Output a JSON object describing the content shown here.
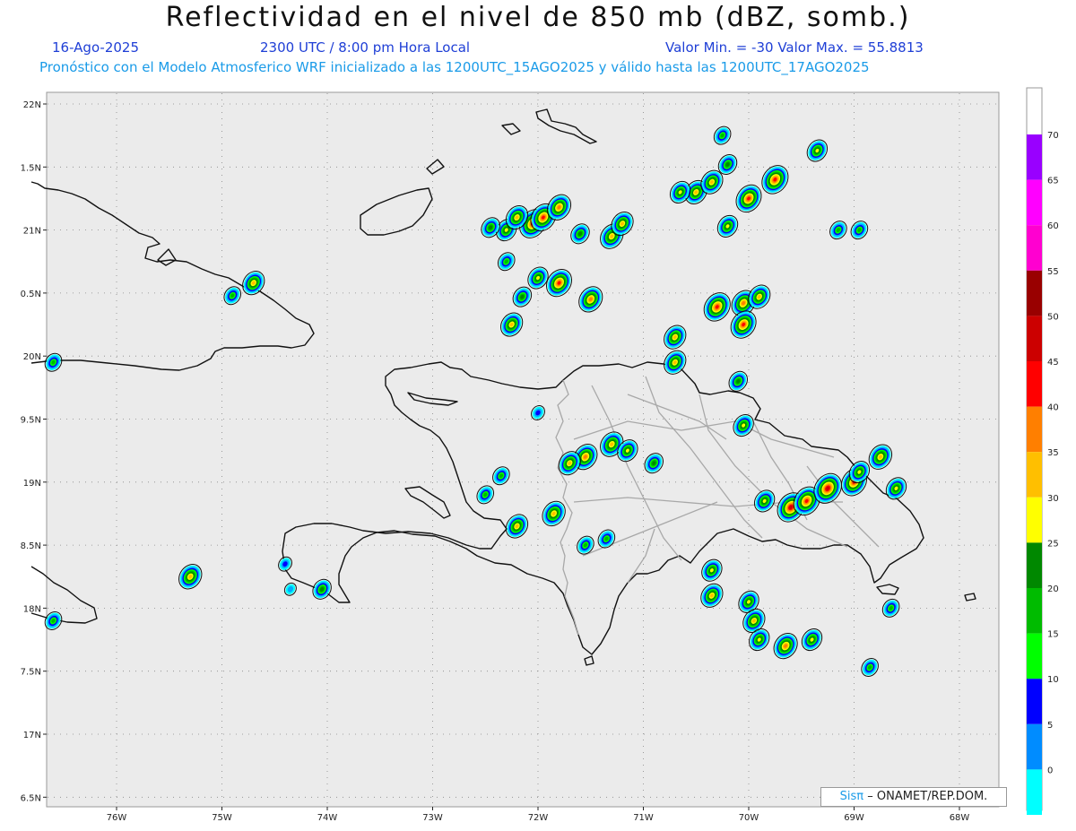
{
  "header": {
    "title": "Reflectividad en el nivel de 850 mb (dBZ, somb.)",
    "date": "16-Ago-2025",
    "time": "2300 UTC / 8:00 pm Hora Local",
    "minmax": "Valor Min. = -30  Valor Max. = 55.8813",
    "forecast": "Pronóstico con el Modelo Atmosferico WRF inicializado a las 1200UTC_15AGO2025 y válido hasta las  1200UTC_17AGO2025"
  },
  "axes": {
    "lat_labels": [
      "22N",
      "1.5N",
      "21N",
      "0.5N",
      "20N",
      "9.5N",
      "19N",
      "8.5N",
      "18N",
      "7.5N",
      "17N",
      "6.5N"
    ],
    "lon_labels": [
      "76W",
      "75W",
      "74W",
      "73W",
      "72W",
      "71W",
      "70W",
      "69W",
      "68W"
    ]
  },
  "colorbar": {
    "labels": [
      "70",
      "65",
      "60",
      "55",
      "50",
      "45",
      "40",
      "35",
      "30",
      "25",
      "20",
      "15",
      "10",
      "5",
      "0"
    ],
    "colors": [
      "#9900ff",
      "#ff00ff",
      "#ff00d0",
      "#990000",
      "#cc0000",
      "#ff0000",
      "#ff7f00",
      "#ffbf00",
      "#ffff00",
      "#008800",
      "#00bb00",
      "#00ff00",
      "#0000ff",
      "#008cff",
      "#00ffff"
    ]
  },
  "credit": {
    "logo": "Sisπ",
    "text": "– ONAMET/REP.DOM."
  },
  "cells": [
    {
      "lon": -72.05,
      "lat": 21.05,
      "dbz": 48
    },
    {
      "lon": -71.95,
      "lat": 21.1,
      "dbz": 45
    },
    {
      "lon": -71.8,
      "lat": 21.18,
      "dbz": 40
    },
    {
      "lon": -72.3,
      "lat": 21.0,
      "dbz": 30
    },
    {
      "lon": -72.2,
      "lat": 21.1,
      "dbz": 35
    },
    {
      "lon": -71.3,
      "lat": 20.95,
      "dbz": 38
    },
    {
      "lon": -71.6,
      "lat": 20.97,
      "dbz": 25
    },
    {
      "lon": -72.3,
      "lat": 20.75,
      "dbz": 20
    },
    {
      "lon": -71.8,
      "lat": 20.58,
      "dbz": 45
    },
    {
      "lon": -72.0,
      "lat": 20.62,
      "dbz": 30
    },
    {
      "lon": -71.5,
      "lat": 20.45,
      "dbz": 40
    },
    {
      "lon": -72.15,
      "lat": 20.47,
      "dbz": 25
    },
    {
      "lon": -72.25,
      "lat": 20.25,
      "dbz": 35
    },
    {
      "lon": -70.3,
      "lat": 20.39,
      "dbz": 48
    },
    {
      "lon": -70.05,
      "lat": 20.42,
      "dbz": 40
    },
    {
      "lon": -69.9,
      "lat": 20.47,
      "dbz": 35
    },
    {
      "lon": -70.05,
      "lat": 20.25,
      "dbz": 45
    },
    {
      "lon": -70.7,
      "lat": 20.15,
      "dbz": 35
    },
    {
      "lon": -70.7,
      "lat": 19.95,
      "dbz": 35
    },
    {
      "lon": -70.1,
      "lat": 19.8,
      "dbz": 25
    },
    {
      "lon": -70.0,
      "lat": 21.25,
      "dbz": 45
    },
    {
      "lon": -69.75,
      "lat": 21.4,
      "dbz": 48
    },
    {
      "lon": -70.5,
      "lat": 21.3,
      "dbz": 35
    },
    {
      "lon": -70.65,
      "lat": 21.3,
      "dbz": 30
    },
    {
      "lon": -70.35,
      "lat": 21.38,
      "dbz": 35
    },
    {
      "lon": -70.2,
      "lat": 21.52,
      "dbz": 25
    },
    {
      "lon": -70.25,
      "lat": 21.75,
      "dbz": 20
    },
    {
      "lon": -70.2,
      "lat": 21.03,
      "dbz": 30
    },
    {
      "lon": -69.35,
      "lat": 21.63,
      "dbz": 30
    },
    {
      "lon": -69.15,
      "lat": 21.0,
      "dbz": 20
    },
    {
      "lon": -68.95,
      "lat": 21.0,
      "dbz": 20
    },
    {
      "lon": -72.45,
      "lat": 21.02,
      "dbz": 25
    },
    {
      "lon": -71.2,
      "lat": 21.05,
      "dbz": 35
    },
    {
      "lon": -71.3,
      "lat": 19.3,
      "dbz": 38
    },
    {
      "lon": -71.15,
      "lat": 19.25,
      "dbz": 30
    },
    {
      "lon": -71.55,
      "lat": 19.2,
      "dbz": 40
    },
    {
      "lon": -71.7,
      "lat": 19.15,
      "dbz": 35
    },
    {
      "lon": -70.9,
      "lat": 19.15,
      "dbz": 25
    },
    {
      "lon": -70.05,
      "lat": 19.45,
      "dbz": 30
    },
    {
      "lon": -69.6,
      "lat": 18.8,
      "dbz": 50
    },
    {
      "lon": -69.45,
      "lat": 18.85,
      "dbz": 48
    },
    {
      "lon": -69.25,
      "lat": 18.95,
      "dbz": 52
    },
    {
      "lon": -69.0,
      "lat": 19.0,
      "dbz": 45
    },
    {
      "lon": -68.75,
      "lat": 19.2,
      "dbz": 38
    },
    {
      "lon": -68.6,
      "lat": 18.95,
      "dbz": 30
    },
    {
      "lon": -68.95,
      "lat": 19.08,
      "dbz": 30
    },
    {
      "lon": -69.85,
      "lat": 18.85,
      "dbz": 30
    },
    {
      "lon": -71.85,
      "lat": 18.75,
      "dbz": 38
    },
    {
      "lon": -72.2,
      "lat": 18.65,
      "dbz": 35
    },
    {
      "lon": -72.5,
      "lat": 18.9,
      "dbz": 20
    },
    {
      "lon": -72.35,
      "lat": 19.05,
      "dbz": 20
    },
    {
      "lon": -74.4,
      "lat": 18.35,
      "dbz": 10
    },
    {
      "lon": -74.35,
      "lat": 18.15,
      "dbz": 5
    },
    {
      "lon": -75.3,
      "lat": 18.25,
      "dbz": 38
    },
    {
      "lon": -76.6,
      "lat": 17.9,
      "dbz": 20
    },
    {
      "lon": -74.05,
      "lat": 18.15,
      "dbz": 25
    },
    {
      "lon": -70.35,
      "lat": 18.3,
      "dbz": 30
    },
    {
      "lon": -70.35,
      "lat": 18.1,
      "dbz": 35
    },
    {
      "lon": -70.0,
      "lat": 18.05,
      "dbz": 30
    },
    {
      "lon": -69.95,
      "lat": 17.9,
      "dbz": 35
    },
    {
      "lon": -69.9,
      "lat": 17.75,
      "dbz": 30
    },
    {
      "lon": -69.65,
      "lat": 17.7,
      "dbz": 40
    },
    {
      "lon": -69.4,
      "lat": 17.75,
      "dbz": 30
    },
    {
      "lon": -68.85,
      "lat": 17.53,
      "dbz": 20
    },
    {
      "lon": -68.65,
      "lat": 18.0,
      "dbz": 20
    },
    {
      "lon": -74.7,
      "lat": 20.58,
      "dbz": 35
    },
    {
      "lon": -74.9,
      "lat": 20.48,
      "dbz": 20
    },
    {
      "lon": -76.6,
      "lat": 19.95,
      "dbz": 20
    },
    {
      "lon": -72.0,
      "lat": 19.55,
      "dbz": 10
    },
    {
      "lon": -71.55,
      "lat": 18.5,
      "dbz": 20
    },
    {
      "lon": -71.35,
      "lat": 18.55,
      "dbz": 20
    }
  ]
}
